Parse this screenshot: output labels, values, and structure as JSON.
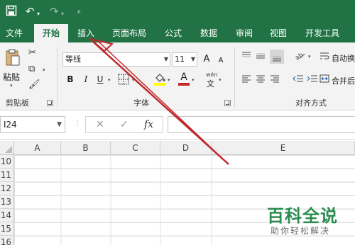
{
  "quick_access": {
    "save_icon": "save-icon",
    "undo_icon": "undo-icon",
    "redo_icon": "redo-icon",
    "customize_icon": "customize-qa-icon"
  },
  "tabs": [
    {
      "label": "文件",
      "active": false
    },
    {
      "label": "开始",
      "active": true
    },
    {
      "label": "插入",
      "active": false
    },
    {
      "label": "页面布局",
      "active": false
    },
    {
      "label": "公式",
      "active": false
    },
    {
      "label": "数据",
      "active": false
    },
    {
      "label": "审阅",
      "active": false
    },
    {
      "label": "视图",
      "active": false
    },
    {
      "label": "开发工具",
      "active": false
    }
  ],
  "clipboard": {
    "paste_label": "粘贴",
    "group_label": "剪贴板"
  },
  "font": {
    "font_name": "等线",
    "font_size": "11",
    "group_label": "字体",
    "bold": "B",
    "italic": "I",
    "underline": "U",
    "grow": "A",
    "shrink": "A",
    "font_color": "A",
    "pinyin": "wén",
    "pinyin_char": "文"
  },
  "alignment": {
    "group_label": "对齐方式",
    "wrap_label": "自动换行",
    "merge_label": "合并后居中"
  },
  "formula_bar": {
    "name_box": "I24",
    "cancel": "✕",
    "enter": "✓",
    "fx": "fx"
  },
  "columns": [
    "A",
    "B",
    "C",
    "D",
    "E"
  ],
  "rows": [
    "10",
    "11",
    "12",
    "13",
    "14",
    "15",
    "16"
  ],
  "watermark": {
    "title": "百科全说",
    "subtitle": "助你轻松解决"
  },
  "colors": {
    "ribbon_green": "#217346",
    "annotation_red": "#c0282a"
  }
}
